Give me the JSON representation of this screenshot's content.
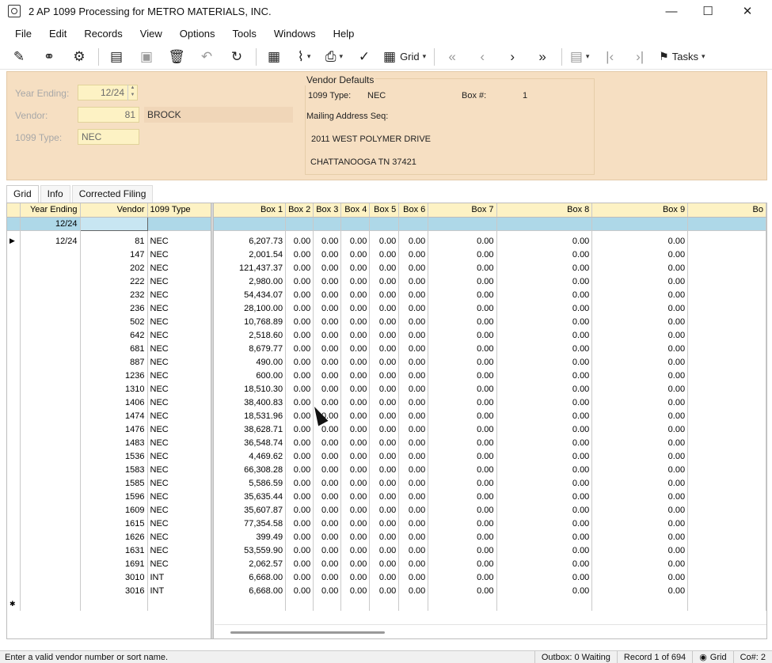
{
  "window": {
    "title": "2 AP 1099 Processing for METRO MATERIALS, INC.",
    "minimize": "—",
    "maximize": "☐",
    "close": "✕"
  },
  "menu": [
    "File",
    "Edit",
    "Records",
    "View",
    "Options",
    "Tools",
    "Windows",
    "Help"
  ],
  "toolbar": {
    "grid_label": "Grid",
    "tasks_label": "Tasks"
  },
  "form": {
    "year_ending_label": "Year Ending:",
    "year_ending_value": "12/24",
    "vendor_label": "Vendor:",
    "vendor_value": "81",
    "vendor_name": "BROCK",
    "type_label": "1099 Type:",
    "type_value": "NEC",
    "vendor_defaults": {
      "title": "Vendor Defaults",
      "type_label": "1099 Type:",
      "type_value": "NEC",
      "box_label": "Box #:",
      "box_value": "1",
      "mailing_label": "Mailing Address Seq:",
      "address_line1": "2011 WEST POLYMER DRIVE",
      "address_line2": "CHATTANOOGA TN 37421"
    }
  },
  "tabs": [
    "Grid",
    "Info",
    "Corrected Filing"
  ],
  "grid": {
    "frozen_headers": [
      "Year Ending",
      "Vendor",
      "1099 Type"
    ],
    "scroll_headers": [
      "Box 1",
      "Box 2",
      "Box 3",
      "Box 4",
      "Box 5",
      "Box 6",
      "Box 7",
      "Box 8",
      "Box 9",
      "Bo"
    ],
    "filter_year": "12/24",
    "rows": [
      {
        "year": "12/24",
        "vendor": "81",
        "type": "NEC",
        "box1": "6,207.73"
      },
      {
        "year": "",
        "vendor": "147",
        "type": "NEC",
        "box1": "2,001.54"
      },
      {
        "year": "",
        "vendor": "202",
        "type": "NEC",
        "box1": "121,437.37"
      },
      {
        "year": "",
        "vendor": "222",
        "type": "NEC",
        "box1": "2,980.00"
      },
      {
        "year": "",
        "vendor": "232",
        "type": "NEC",
        "box1": "54,434.07"
      },
      {
        "year": "",
        "vendor": "236",
        "type": "NEC",
        "box1": "28,100.00"
      },
      {
        "year": "",
        "vendor": "502",
        "type": "NEC",
        "box1": "10,768.89"
      },
      {
        "year": "",
        "vendor": "642",
        "type": "NEC",
        "box1": "2,518.60"
      },
      {
        "year": "",
        "vendor": "681",
        "type": "NEC",
        "box1": "8,679.77"
      },
      {
        "year": "",
        "vendor": "887",
        "type": "NEC",
        "box1": "490.00"
      },
      {
        "year": "",
        "vendor": "1236",
        "type": "NEC",
        "box1": "600.00"
      },
      {
        "year": "",
        "vendor": "1310",
        "type": "NEC",
        "box1": "18,510.30"
      },
      {
        "year": "",
        "vendor": "1406",
        "type": "NEC",
        "box1": "38,400.83"
      },
      {
        "year": "",
        "vendor": "1474",
        "type": "NEC",
        "box1": "18,531.96"
      },
      {
        "year": "",
        "vendor": "1476",
        "type": "NEC",
        "box1": "38,628.71"
      },
      {
        "year": "",
        "vendor": "1483",
        "type": "NEC",
        "box1": "36,548.74"
      },
      {
        "year": "",
        "vendor": "1536",
        "type": "NEC",
        "box1": "4,469.62"
      },
      {
        "year": "",
        "vendor": "1583",
        "type": "NEC",
        "box1": "66,308.28"
      },
      {
        "year": "",
        "vendor": "1585",
        "type": "NEC",
        "box1": "5,586.59"
      },
      {
        "year": "",
        "vendor": "1596",
        "type": "NEC",
        "box1": "35,635.44"
      },
      {
        "year": "",
        "vendor": "1609",
        "type": "NEC",
        "box1": "35,607.87"
      },
      {
        "year": "",
        "vendor": "1615",
        "type": "NEC",
        "box1": "77,354.58"
      },
      {
        "year": "",
        "vendor": "1626",
        "type": "NEC",
        "box1": "399.49"
      },
      {
        "year": "",
        "vendor": "1631",
        "type": "NEC",
        "box1": "53,559.90"
      },
      {
        "year": "",
        "vendor": "1691",
        "type": "NEC",
        "box1": "2,062.57"
      },
      {
        "year": "",
        "vendor": "3010",
        "type": "INT",
        "box1": "6,668.00"
      },
      {
        "year": "",
        "vendor": "3016",
        "type": "INT",
        "box1": "6,668.00"
      }
    ],
    "zero_value": "0.00",
    "current_row_marker": "▶",
    "new_row_marker": "✱"
  },
  "status": {
    "message": "Enter a valid vendor number or sort name.",
    "outbox": "Outbox: 0 Waiting",
    "record": "Record 1 of 694",
    "view": "Grid",
    "company": "Co#: 2"
  }
}
